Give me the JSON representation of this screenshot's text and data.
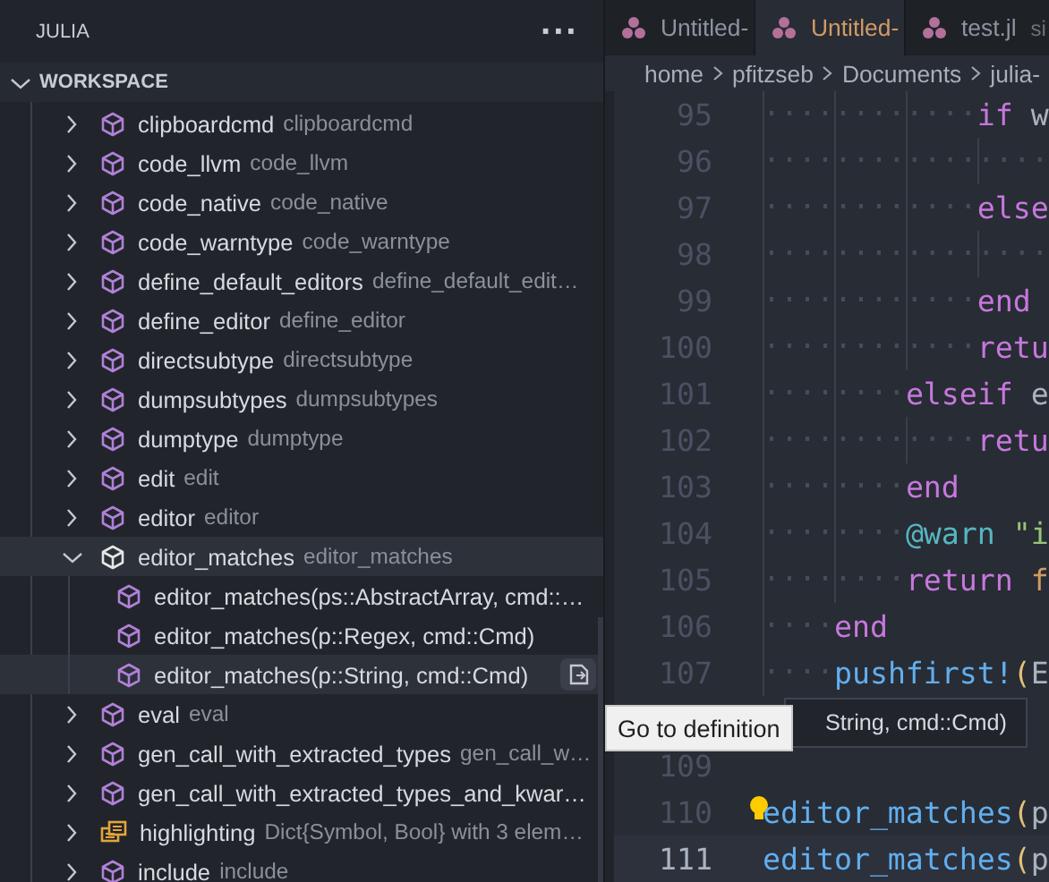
{
  "sidebar": {
    "title": "JULIA",
    "more": "···",
    "section": {
      "label": "WORKSPACE",
      "expanded": true
    },
    "items": [
      {
        "label": "clipboardcmd",
        "description": "clipboardcmd",
        "kind": "function",
        "expanded": false,
        "selected": false,
        "hovered": false
      },
      {
        "label": "code_llvm",
        "description": "code_llvm",
        "kind": "function",
        "expanded": false,
        "selected": false,
        "hovered": false
      },
      {
        "label": "code_native",
        "description": "code_native",
        "kind": "function",
        "expanded": false,
        "selected": false,
        "hovered": false
      },
      {
        "label": "code_warntype",
        "description": "code_warntype",
        "kind": "function",
        "expanded": false,
        "selected": false,
        "hovered": false
      },
      {
        "label": "define_default_editors",
        "description": "define_default_edit…",
        "kind": "function",
        "expanded": false,
        "selected": false,
        "hovered": false
      },
      {
        "label": "define_editor",
        "description": "define_editor",
        "kind": "function",
        "expanded": false,
        "selected": false,
        "hovered": false
      },
      {
        "label": "directsubtype",
        "description": "directsubtype",
        "kind": "function",
        "expanded": false,
        "selected": false,
        "hovered": false
      },
      {
        "label": "dumpsubtypes",
        "description": "dumpsubtypes",
        "kind": "function",
        "expanded": false,
        "selected": false,
        "hovered": false
      },
      {
        "label": "dumptype",
        "description": "dumptype",
        "kind": "function",
        "expanded": false,
        "selected": false,
        "hovered": false
      },
      {
        "label": "edit",
        "description": "edit",
        "kind": "function",
        "expanded": false,
        "selected": false,
        "hovered": false
      },
      {
        "label": "editor",
        "description": "editor",
        "kind": "function",
        "expanded": false,
        "selected": false,
        "hovered": false
      },
      {
        "label": "editor_matches",
        "description": "editor_matches",
        "kind": "function",
        "expanded": true,
        "selected": true,
        "hovered": false,
        "children": [
          {
            "label": "editor_matches(ps::AbstractArray, cmd::…",
            "kind": "method",
            "selected": false,
            "hovered": false
          },
          {
            "label": "editor_matches(p::Regex, cmd::Cmd)",
            "kind": "method",
            "selected": false,
            "hovered": false
          },
          {
            "label": "editor_matches(p::String, cmd::Cmd)",
            "kind": "method",
            "selected": false,
            "hovered": true
          }
        ]
      },
      {
        "label": "eval",
        "description": "eval",
        "kind": "function",
        "expanded": false,
        "selected": false,
        "hovered": false
      },
      {
        "label": "gen_call_with_extracted_types",
        "description": "gen_call_w…",
        "kind": "function",
        "expanded": false,
        "selected": false,
        "hovered": false
      },
      {
        "label": "gen_call_with_extracted_types_and_kwar…",
        "kind": "function",
        "expanded": false,
        "selected": false,
        "hovered": false
      },
      {
        "label": "highlighting",
        "description": "Dict{Symbol, Bool} with 3 elem…",
        "kind": "variable",
        "expanded": false,
        "selected": false,
        "hovered": false
      },
      {
        "label": "include",
        "description": "include",
        "kind": "function",
        "expanded": false,
        "selected": false,
        "hovered": false
      }
    ]
  },
  "tooltip": "Go to definition",
  "tabs": [
    {
      "label": "Untitled-",
      "selected": false,
      "modified": false
    },
    {
      "label": "Untitled-",
      "selected": true,
      "modified": true
    },
    {
      "label": "test.jl",
      "description": "si",
      "selected": false,
      "modified": false
    }
  ],
  "breadcrumb": [
    "home",
    "pfitzseb",
    "Documents",
    "julia-"
  ],
  "hover": "String, cmd::Cmd)",
  "lines": [
    {
      "kind": "code",
      "number": "95",
      "current": false,
      "tokens": [
        {
          "kind": "whitespace",
          "s": "············"
        },
        {
          "kind": "keyword",
          "s": "if"
        },
        {
          "kind": "plain",
          "s": " w"
        }
      ]
    },
    {
      "kind": "code",
      "number": "96",
      "current": false,
      "tokens": [
        {
          "kind": "whitespace",
          "s": "················"
        }
      ]
    },
    {
      "kind": "code",
      "number": "97",
      "current": false,
      "tokens": [
        {
          "kind": "whitespace",
          "s": "············"
        },
        {
          "kind": "keyword",
          "s": "else"
        }
      ]
    },
    {
      "kind": "code",
      "number": "98",
      "current": false,
      "tokens": [
        {
          "kind": "whitespace",
          "s": "················"
        }
      ]
    },
    {
      "kind": "code",
      "number": "99",
      "current": false,
      "tokens": [
        {
          "kind": "whitespace",
          "s": "············"
        },
        {
          "kind": "keyword",
          "s": "end"
        }
      ]
    },
    {
      "kind": "code",
      "number": "100",
      "current": false,
      "tokens": [
        {
          "kind": "whitespace",
          "s": "············"
        },
        {
          "kind": "keyword",
          "s": "retu"
        }
      ]
    },
    {
      "kind": "code",
      "number": "101",
      "current": false,
      "tokens": [
        {
          "kind": "whitespace",
          "s": "········"
        },
        {
          "kind": "keyword",
          "s": "elseif"
        },
        {
          "kind": "plain",
          "s": " e"
        }
      ]
    },
    {
      "kind": "code",
      "number": "102",
      "current": false,
      "tokens": [
        {
          "kind": "whitespace",
          "s": "············"
        },
        {
          "kind": "keyword",
          "s": "retu"
        }
      ]
    },
    {
      "kind": "code",
      "number": "103",
      "current": false,
      "tokens": [
        {
          "kind": "whitespace",
          "s": "········"
        },
        {
          "kind": "keyword",
          "s": "end"
        }
      ]
    },
    {
      "kind": "code",
      "number": "104",
      "current": false,
      "tokens": [
        {
          "kind": "whitespace",
          "s": "········"
        },
        {
          "kind": "macro",
          "s": "@warn"
        },
        {
          "kind": "string",
          "s": " \"i"
        }
      ]
    },
    {
      "kind": "code",
      "number": "105",
      "current": false,
      "tokens": [
        {
          "kind": "whitespace",
          "s": "········"
        },
        {
          "kind": "keyword",
          "s": "return"
        },
        {
          "kind": "constant",
          "s": " f"
        }
      ]
    },
    {
      "kind": "code",
      "number": "106",
      "current": false,
      "tokens": [
        {
          "kind": "whitespace",
          "s": "····"
        },
        {
          "kind": "keyword",
          "s": "end"
        }
      ]
    },
    {
      "kind": "code",
      "number": "107",
      "current": false,
      "tokens": [
        {
          "kind": "whitespace",
          "s": "····"
        },
        {
          "kind": "function",
          "s": "pushfirst!"
        },
        {
          "kind": "paren",
          "s": "("
        },
        {
          "kind": "plain",
          "s": "E"
        }
      ]
    },
    {
      "kind": "covered"
    },
    {
      "kind": "code",
      "number": "109",
      "current": false
    },
    {
      "kind": "code",
      "number": "110",
      "current": false,
      "bulb": true,
      "tokens": [
        {
          "kind": "function",
          "s": "editor_matches"
        },
        {
          "kind": "paren",
          "s": "("
        },
        {
          "kind": "plain",
          "s": "p"
        }
      ]
    },
    {
      "kind": "code",
      "number": "111",
      "current": true,
      "tokens": [
        {
          "kind": "function",
          "s": "editor_matches"
        },
        {
          "kind": "paren",
          "s": "("
        },
        {
          "kind": "plain",
          "s": "p"
        }
      ]
    }
  ]
}
